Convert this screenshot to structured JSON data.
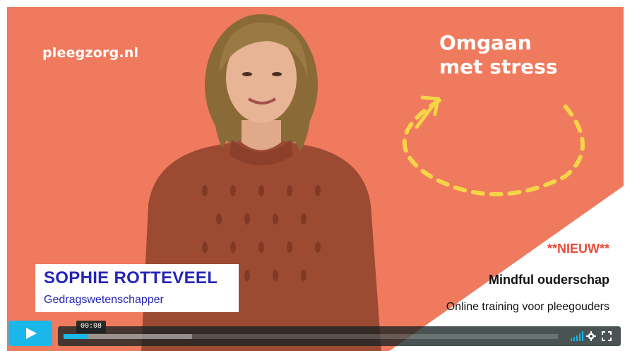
{
  "brand": {
    "logo_text": "pleegzorg.nl"
  },
  "title": {
    "line1": "Omgaan",
    "line2": "met stress"
  },
  "presenter": {
    "name": "SOPHIE ROTTEVEEL",
    "role": "Gedragswetenschapper"
  },
  "promo": {
    "tag": "**NIEUW**",
    "title": "Mindful ouderschap",
    "subtitle": "Online training voor pleegouders"
  },
  "player": {
    "current_time": "00:08",
    "progress_fraction": 0.05,
    "buffered_fraction": 0.26,
    "controls": {
      "play_icon": "play-icon",
      "volume_icon": "volume-bars-icon",
      "settings_icon": "gear-icon",
      "fullscreen_icon": "fullscreen-icon"
    }
  },
  "colors": {
    "background": "#f07a5e",
    "accent_blue": "#1ab7ea",
    "name_blue": "#2525b8",
    "promo_red": "#e84c3a",
    "dash_yellow": "#f5d547"
  }
}
